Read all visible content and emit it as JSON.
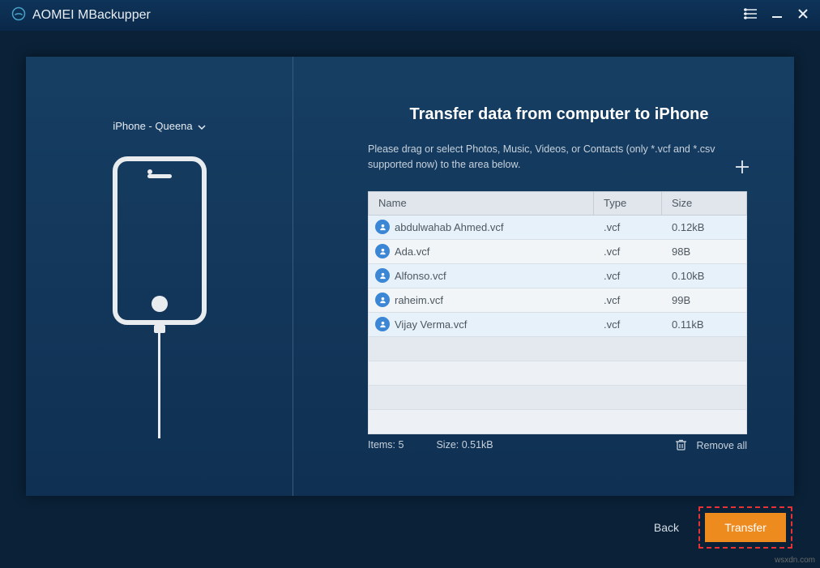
{
  "app": {
    "title": "AOMEI MBackupper"
  },
  "window": {
    "menu_icon": "menu-list-icon",
    "min_icon": "minimize-icon",
    "close_icon": "close-icon"
  },
  "device": {
    "name": "iPhone - Queena"
  },
  "panel": {
    "title": "Transfer data from computer to iPhone",
    "subtitle": "Please drag or select Photos, Music, Videos, or Contacts (only *.vcf and *.csv supported now) to the area below."
  },
  "table": {
    "headers": {
      "name": "Name",
      "type": "Type",
      "size": "Size"
    },
    "rows": [
      {
        "name": "abdulwahab Ahmed.vcf",
        "type": ".vcf",
        "size": "0.12kB"
      },
      {
        "name": "Ada.vcf",
        "type": ".vcf",
        "size": "98B"
      },
      {
        "name": "Alfonso.vcf",
        "type": ".vcf",
        "size": "0.10kB"
      },
      {
        "name": "raheim.vcf",
        "type": ".vcf",
        "size": "99B"
      },
      {
        "name": "Vijay Verma.vcf",
        "type": ".vcf",
        "size": "0.11kB"
      }
    ]
  },
  "status": {
    "items_label": "Items: 5",
    "size_label": "Size: 0.51kB",
    "remove_all": "Remove all"
  },
  "footer": {
    "back": "Back",
    "transfer": "Transfer"
  },
  "watermark": "wsxdn.com"
}
